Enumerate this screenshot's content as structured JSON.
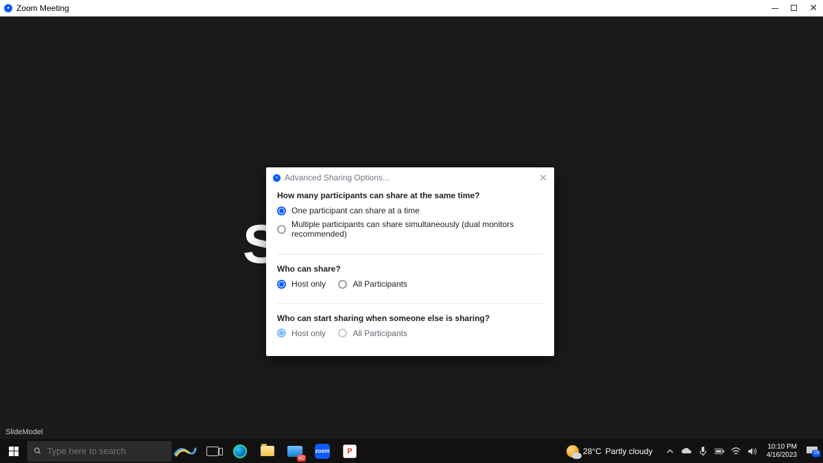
{
  "window": {
    "title": "Zoom Meeting"
  },
  "background": {
    "watermark": "SlideModel",
    "avatar_letter": "S"
  },
  "dialog": {
    "title": "Advanced Sharing Options...",
    "q1": {
      "question": "How many participants can share at the same time?",
      "opt_a": "One participant can share at a time",
      "opt_b": "Multiple participants can share simultaneously (dual monitors recommended)",
      "selected": "a"
    },
    "q2": {
      "question": "Who can share?",
      "opt_a": "Host only",
      "opt_b": "All Participants",
      "selected": "a"
    },
    "q3": {
      "question": "Who can start sharing when someone else is sharing?",
      "opt_a": "Host only",
      "opt_b": "All Participants",
      "selected": "a"
    }
  },
  "taskbar": {
    "search_placeholder": "Type here to search",
    "mail_badge": "60",
    "zoom_label": "zoom",
    "ppt_label": "P",
    "weather_temp": "28°C",
    "weather_cond": "Partly cloudy",
    "time": "10:10 PM",
    "date": "4/16/2023",
    "notif_count": "19"
  }
}
